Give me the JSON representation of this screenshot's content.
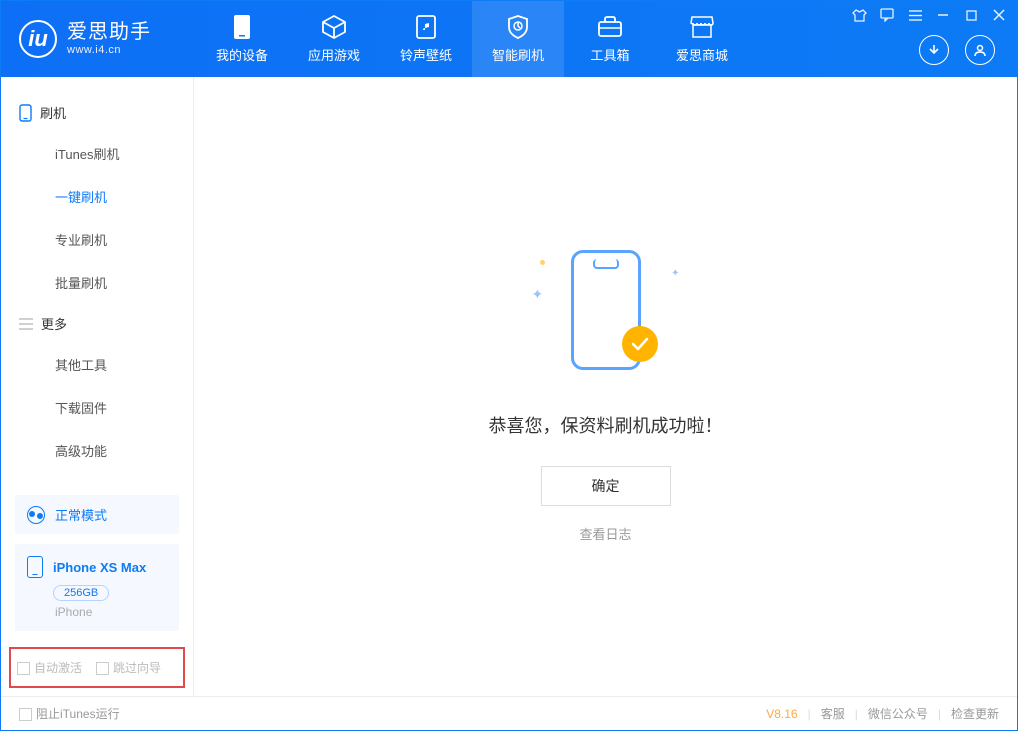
{
  "app": {
    "title": "爱思助手",
    "subtitle": "www.i4.cn"
  },
  "nav": [
    {
      "label": "我的设备",
      "icon": "device"
    },
    {
      "label": "应用游戏",
      "icon": "cube"
    },
    {
      "label": "铃声壁纸",
      "icon": "music"
    },
    {
      "label": "智能刷机",
      "icon": "shield",
      "active": true
    },
    {
      "label": "工具箱",
      "icon": "toolbox"
    },
    {
      "label": "爱思商城",
      "icon": "store"
    }
  ],
  "sidebar": {
    "group1": {
      "title": "刷机"
    },
    "items1": [
      {
        "label": "iTunes刷机"
      },
      {
        "label": "一键刷机",
        "active": true
      },
      {
        "label": "专业刷机"
      },
      {
        "label": "批量刷机"
      }
    ],
    "group2": {
      "title": "更多"
    },
    "items2": [
      {
        "label": "其他工具"
      },
      {
        "label": "下载固件"
      },
      {
        "label": "高级功能"
      }
    ],
    "mode": "正常模式",
    "device": {
      "name": "iPhone XS Max",
      "storage": "256GB",
      "type": "iPhone"
    },
    "options": {
      "autoActivate": "自动激活",
      "skipGuide": "跳过向导"
    }
  },
  "main": {
    "successMessage": "恭喜您，保资料刷机成功啦！",
    "okButton": "确定",
    "viewLog": "查看日志"
  },
  "status": {
    "blockItunes": "阻止iTunes运行",
    "version": "V8.16",
    "support": "客服",
    "wechat": "微信公众号",
    "checkUpdate": "检查更新"
  }
}
